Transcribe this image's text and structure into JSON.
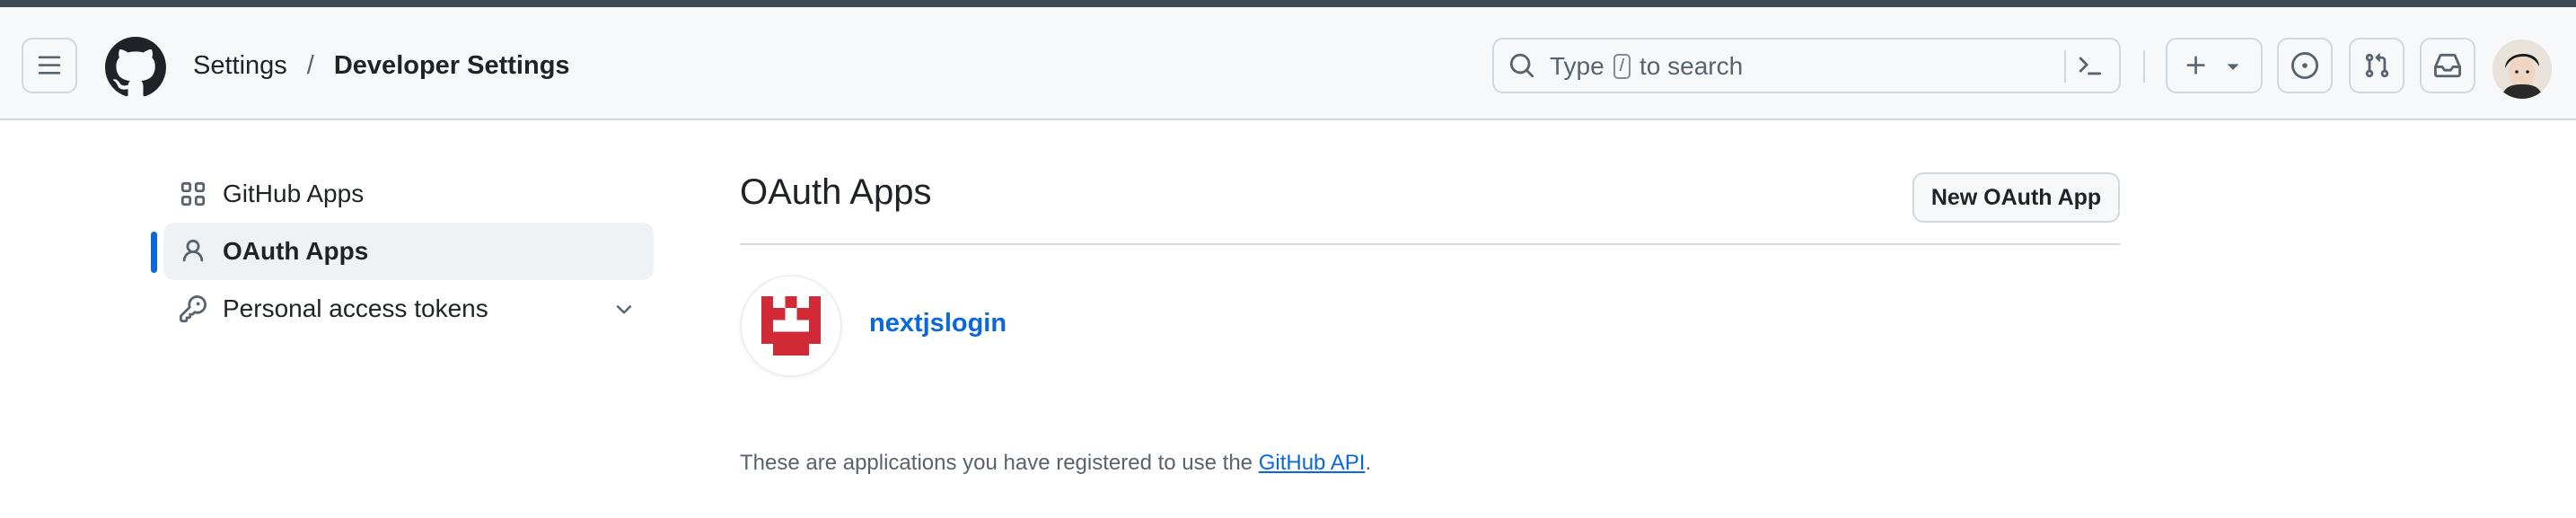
{
  "header": {
    "breadcrumb": {
      "parent": "Settings",
      "separator": "/",
      "current": "Developer Settings"
    },
    "search": {
      "prefix": "Type",
      "key": "/",
      "suffix": "to search"
    }
  },
  "sidebar": {
    "items": [
      {
        "label": "GitHub Apps",
        "icon": "apps-grid-icon",
        "active": false
      },
      {
        "label": "OAuth Apps",
        "icon": "person-icon",
        "active": true
      },
      {
        "label": "Personal access tokens",
        "icon": "key-icon",
        "active": false,
        "expandable": true
      }
    ]
  },
  "main": {
    "title": "OAuth Apps",
    "new_button": "New OAuth App",
    "apps": [
      {
        "name": "nextjslogin"
      }
    ],
    "footer": {
      "text": "These are applications you have registered to use the",
      "link": "GitHub API",
      "period": "."
    }
  },
  "colors": {
    "accent": "#0969da",
    "border": "#d1d9e0",
    "header_bg": "#f6f8fa",
    "app_icon": "#cf2a36"
  }
}
